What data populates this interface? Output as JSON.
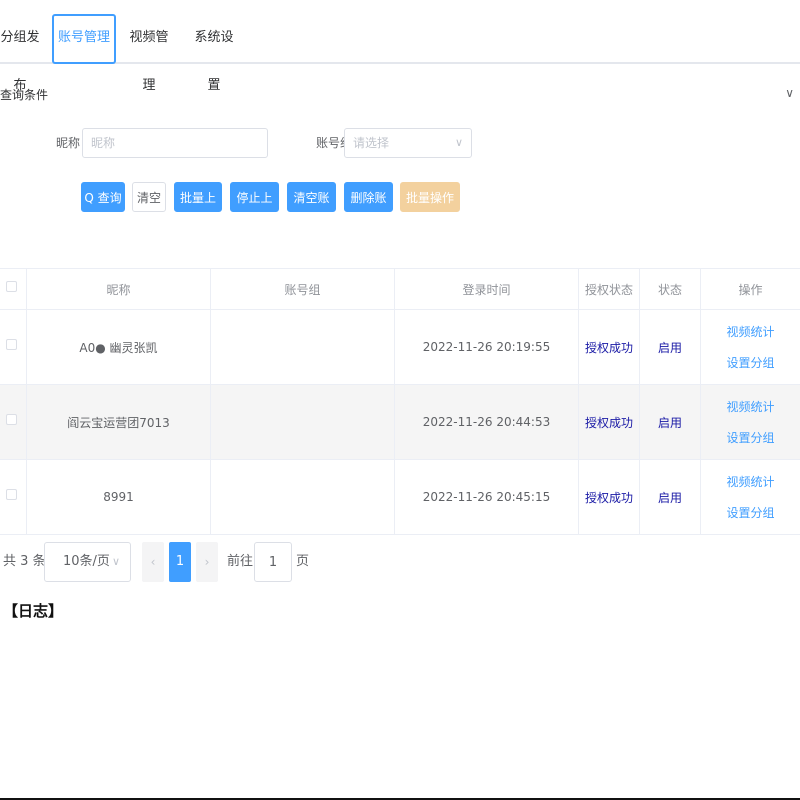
{
  "tabs": [
    {
      "label": "分组发布"
    },
    {
      "label": "账号管理"
    },
    {
      "label": "视频管理"
    },
    {
      "label": "系统设置"
    }
  ],
  "query": {
    "title": "查询条件",
    "collapse_icon": "chevron-down",
    "nickname_label": "昵称",
    "nickname_placeholder": "昵称",
    "group_label": "账号组",
    "group_placeholder": "请选择"
  },
  "buttons": {
    "search": "Q 查询",
    "clear": "清空",
    "batch_login": "批量上号",
    "stop_login": "停止上号",
    "clear_accounts": "清空账号",
    "delete_accounts": "删除账号",
    "batch_ops": "批量操作 ∨"
  },
  "table": {
    "headers": [
      "昵称",
      "账号组",
      "登录时间",
      "授权状态",
      "状态",
      "操作"
    ],
    "rows": [
      {
        "nickname": "A0● 幽灵张凯",
        "group": "",
        "login_time": "2022-11-26 20:19:55",
        "auth": "授权成功",
        "status": "启用",
        "op1": "视频统计",
        "op2": "设置分组"
      },
      {
        "nickname": "阎云宝运营团7013",
        "group": "",
        "login_time": "2022-11-26 20:44:53",
        "auth": "授权成功",
        "status": "启用",
        "op1": "视频统计",
        "op2": "设置分组"
      },
      {
        "nickname": "8991",
        "group": "",
        "login_time": "2022-11-26 20:45:15",
        "auth": "授权成功",
        "status": "启用",
        "op1": "视频统计",
        "op2": "设置分组"
      }
    ]
  },
  "pagination": {
    "total": "共 3 条",
    "page_size": "10条/页",
    "prev": "‹",
    "current": "1",
    "next": "›",
    "goto_prefix": "前往",
    "goto_value": "1",
    "goto_suffix": "页"
  },
  "log": {
    "title": "【日志】"
  },
  "colors": {
    "primary": "#409eff",
    "warning_light": "#f3d19e",
    "auth_text": "#1a1aa6"
  }
}
